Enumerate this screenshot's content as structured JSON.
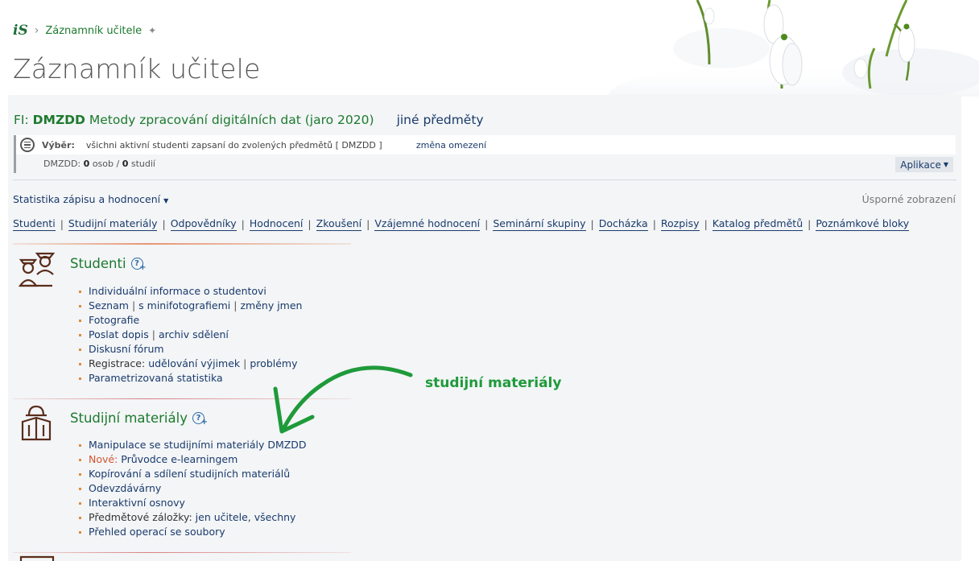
{
  "header": {
    "logo": "iS",
    "breadcrumb": "Záznamník učitele",
    "page_title": "Záznamník učitele"
  },
  "course": {
    "faculty": "FI:",
    "code": "DMZDD",
    "name": "Metody zpracování digitálních dat (jaro 2020)",
    "other_link": "jiné předměty"
  },
  "filter": {
    "label": "Výběr:",
    "text": "všichni aktivní studenti zapsaní do zvolených předmětů [ DMZDD ]",
    "change_link": "změna omezení",
    "summary_code": "DMZDD:",
    "persons": "0",
    "persons_unit": "osob",
    "slash": "/",
    "studies": "0",
    "studies_unit": "studií",
    "apps_button": "Aplikace"
  },
  "stats_menu": "Statistika zápisu a hodnocení",
  "compact_view": "Úsporné zobrazení",
  "tabs": [
    "Studenti",
    "Studijní materiály",
    "Odpovědníky",
    "Hodnocení",
    "Zkoušení",
    "Vzájemné hodnocení",
    "Seminární skupiny",
    "Docházka",
    "Rozpisy",
    "Katalog předmětů",
    "Poznámkové bloky"
  ],
  "sections": {
    "students": {
      "title": "Studenti",
      "items": {
        "individual": "Individuální informace o studentovi",
        "list": "Seznam",
        "minifoto": "s minifotografiemi",
        "name_changes": "změny jmen",
        "photos": "Fotografie",
        "send_letter": "Poslat dopis",
        "archive": "archiv sdělení",
        "forum": "Diskusní fórum",
        "registration_label": "Registrace:",
        "exceptions": "udělování výjimek",
        "problems": "problémy",
        "param_stats": "Parametrizovaná statistika"
      }
    },
    "materials": {
      "title": "Studijní materiály",
      "items": {
        "manipulation": "Manipulace se studijními materiály DMZDD",
        "new_label": "Nové:",
        "elearning": "Průvodce e-learningem",
        "copy_share": "Kopírování a sdílení studijních materiálů",
        "dropboxes": "Odevzdávárny",
        "syllabus": "Interaktivní osnovy",
        "tabs_label": "Předmětové záložky:",
        "teachers_only": "jen učitele",
        "comma": ",",
        "all": "všechny",
        "file_ops": "Přehled operací se soubory"
      }
    }
  },
  "annotation": "studijní materiály",
  "colors": {
    "green_accent": "#1d7a2e",
    "annotation_green": "#1f9a3a",
    "link_blue": "#1a3a6b",
    "bullet_orange": "#e08a3a",
    "new_red": "#d2542f"
  }
}
